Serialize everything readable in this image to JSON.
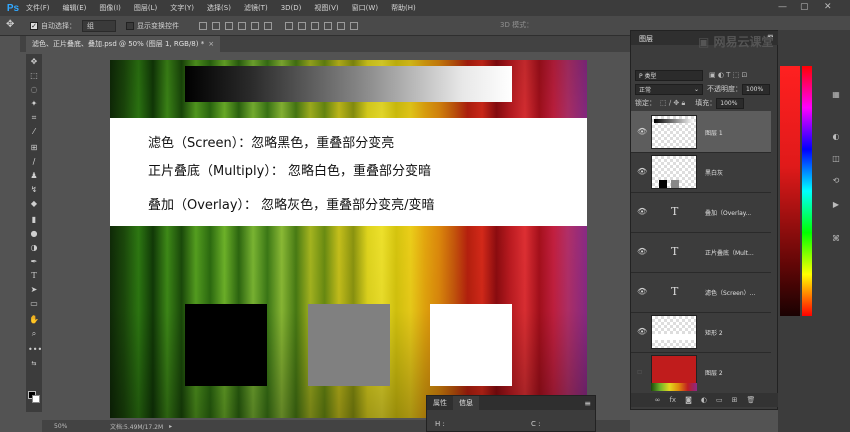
{
  "app": {
    "logo": "Ps"
  },
  "menu": [
    "文件(F)",
    "编辑(E)",
    "图像(I)",
    "图层(L)",
    "文字(Y)",
    "选择(S)",
    "滤镜(T)",
    "3D(D)",
    "视图(V)",
    "窗口(W)",
    "帮助(H)"
  ],
  "options": {
    "auto_select_label": "自动选择：",
    "auto_select_value": "组",
    "transform_label": "显示变换控件",
    "mode_3d": "3D 模式："
  },
  "document": {
    "tab_title": "滤色、正片叠底、叠加.psd @ 50% (图层 1, RGB/8) *",
    "close": "×"
  },
  "canvas": {
    "lines": [
      "滤色（Screen）：忽略黑色，重叠部分变亮",
      "正片叠底（Multiply）： 忽略白色，重叠部分变暗",
      "叠加（Overlay）： 忽略灰色，重叠部分变亮/变暗"
    ],
    "square_colors": [
      "#000000",
      "#808080",
      "#ffffff"
    ]
  },
  "status": {
    "zoom": "50%",
    "doc": "文档:5.49M/17.2M"
  },
  "layers_panel": {
    "tab": "图层",
    "filter": "P 类型",
    "blend_mode": "正常",
    "opacity_label": "不透明度：",
    "opacity_value": "100%",
    "lock_label": "锁定：",
    "fill_label": "填充：",
    "fill_value": "100%",
    "layers": [
      {
        "name": "图层 1",
        "kind": "pixel",
        "selected": true
      },
      {
        "name": "黑白灰",
        "kind": "pixel",
        "selected": false
      },
      {
        "name": "叠加（Overlay...",
        "kind": "text",
        "selected": false
      },
      {
        "name": "正片叠底（Mult...",
        "kind": "text",
        "selected": false
      },
      {
        "name": "滤色（Screen）...",
        "kind": "text",
        "selected": false
      },
      {
        "name": "矩形 2",
        "kind": "shape",
        "selected": false
      },
      {
        "name": "图层 2",
        "kind": "fill",
        "selected": false
      }
    ],
    "footer_icons": [
      "link-icon",
      "fx-icon",
      "mask-icon",
      "adjustment-icon",
      "group-icon",
      "new-layer-icon",
      "trash-icon"
    ]
  },
  "info_panel": {
    "tabs": [
      "属性",
      "信息"
    ],
    "h_label": "H :",
    "c_label": "C :"
  },
  "watermark": "网易云课堂"
}
